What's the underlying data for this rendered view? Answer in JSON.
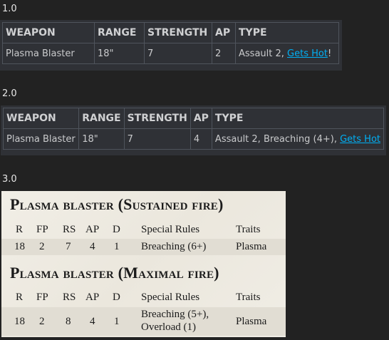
{
  "versions": [
    "1.0",
    "2.0",
    "3.0"
  ],
  "table_v1": {
    "headers": [
      "WEAPON",
      "RANGE",
      "STRENGTH",
      "AP",
      "TYPE"
    ],
    "row": {
      "weapon": "Plasma Blaster",
      "range": "18\"",
      "strength": "7",
      "ap": "2",
      "type_prefix": "Assault 2, ",
      "link": "Gets Hot",
      "type_suffix": "!"
    }
  },
  "table_v2": {
    "headers": [
      "WEAPON",
      "RANGE",
      "STRENGTH",
      "AP",
      "TYPE"
    ],
    "row": {
      "weapon": "Plasma Blaster",
      "range": "18\"",
      "strength": "7",
      "ap": "4",
      "type_prefix": "Assault 2, Breaching (4+), ",
      "link": "Gets Hot"
    }
  },
  "rulebook": {
    "profiles": [
      {
        "title": "Plasma blaster (Sustained fire)",
        "headers": [
          "R",
          "FP",
          "RS",
          "AP",
          "D",
          "Special Rules",
          "Traits"
        ],
        "values": [
          "18",
          "2",
          "7",
          "4",
          "1"
        ],
        "special_rules": [
          "Breaching (6+)"
        ],
        "traits": "Plasma"
      },
      {
        "title": "Plasma blaster (Maximal fire)",
        "headers": [
          "R",
          "FP",
          "RS",
          "AP",
          "D",
          "Special Rules",
          "Traits"
        ],
        "values": [
          "18",
          "2",
          "8",
          "4",
          "1"
        ],
        "special_rules": [
          "Breaching (5+),",
          "Overload (1)"
        ],
        "traits": "Plasma"
      }
    ]
  },
  "colors": {
    "background": "#222222",
    "table_bg": "#2f3136",
    "link": "#00aff4",
    "parchment": "#efece4"
  }
}
